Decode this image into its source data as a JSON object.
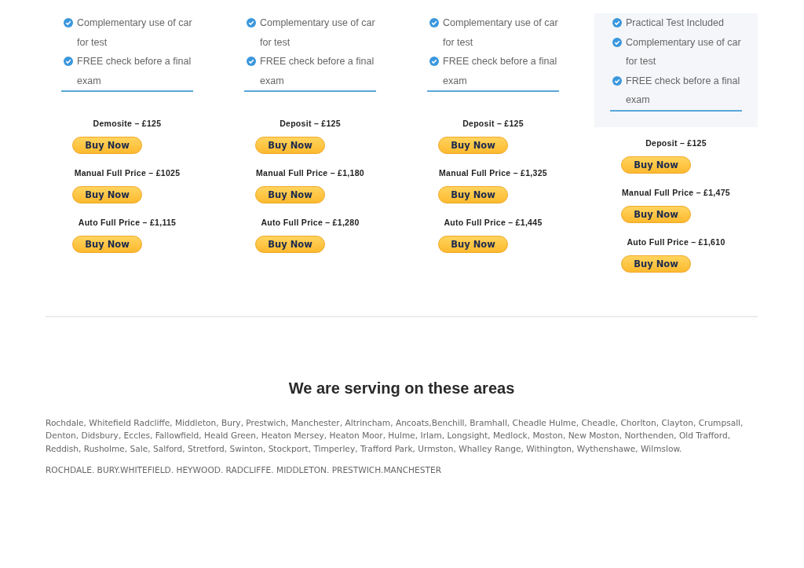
{
  "plans": [
    {
      "kind": "standard",
      "features": [
        "Complementary use of car for test",
        "FREE check before a final exam"
      ],
      "prices": [
        {
          "label": "Demosite – £125",
          "button": "Buy Now"
        },
        {
          "label": "Manual Full Price – £1025",
          "button": "Buy Now"
        },
        {
          "label": "Auto Full Price – £1,115",
          "button": "Buy Now"
        }
      ]
    },
    {
      "kind": "standard",
      "features": [
        "Complementary use of car for test",
        "FREE check before a final exam"
      ],
      "prices": [
        {
          "label": "Deposit – £125",
          "button": "Buy Now"
        },
        {
          "label": "Manual Full Price – £1,180",
          "button": "Buy Now"
        },
        {
          "label": "Auto Full Price – £1,280",
          "button": "Buy Now"
        }
      ]
    },
    {
      "kind": "standard",
      "features": [
        "Complementary use of car for test",
        "FREE check before a final exam"
      ],
      "prices": [
        {
          "label": "Deposit – £125",
          "button": "Buy Now"
        },
        {
          "label": "Manual Full Price – £1,325",
          "button": "Buy Now"
        },
        {
          "label": "Auto Full Price – £1,445",
          "button": "Buy Now"
        }
      ]
    },
    {
      "kind": "featured",
      "features": [
        "Practical Test Included",
        "Complementary use of car for test",
        "FREE check before a final exam"
      ],
      "prices": [
        {
          "label": "Deposit – £125",
          "button": "Buy Now"
        },
        {
          "label": "Manual Full Price – £1,475",
          "button": "Buy Now"
        },
        {
          "label": "Auto Full Price – £1,610",
          "button": "Buy Now"
        }
      ]
    }
  ],
  "areas": {
    "heading": "We are serving on these areas",
    "paragraphs": [
      "Rochdale, Whitefield Radcliffe, Middleton, Bury, Prestwich, Manchester, Altrincham, Ancoats,Benchill, Bramhall, Cheadle Hulme, Cheadle, Chorlton, Clayton, Crumpsall, Denton, Didsbury, Eccles, Fallowfield, Heald Green, Heaton Mersey, Heaton Moor, Hulme, Irlam, Longsight, Medlock, Moston, New Moston, Northenden, Old Trafford, Reddish, Rusholme, Sale, Salford, Stretford, Swinton, Stockport, Timperley, Trafford Park, Urmston, Whalley Range, Withington, Wythenshawe, Wilmslow.",
      "ROCHDALE. BURY.WHITEFIELD. HEYWOOD. RADCLIFFE. MIDDLETON. PRESTWICH.MANCHESTER"
    ]
  }
}
